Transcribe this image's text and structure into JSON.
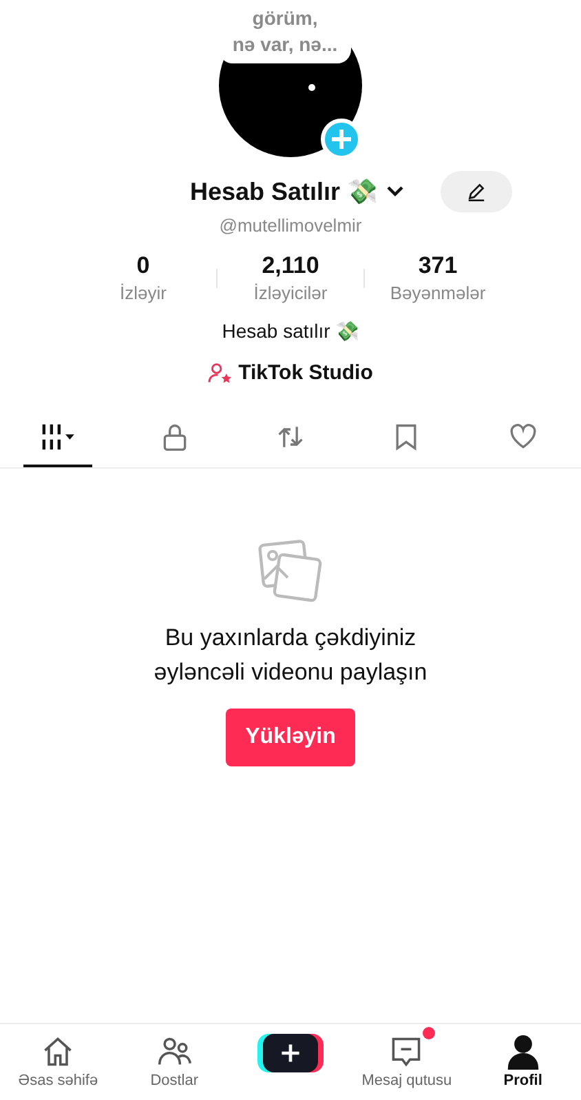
{
  "profile": {
    "note": "görüm,\nnə var, nə...",
    "name": "Hesab Satılır 💸",
    "handle": "@mutellimovelmir",
    "bio": "Hesab satılır 💸",
    "studio": "TikTok Studio"
  },
  "stats": [
    {
      "value": "0",
      "label": "İzləyir"
    },
    {
      "value": "2,110",
      "label": "İzləyicilər"
    },
    {
      "value": "371",
      "label": "Bəyənmələr"
    }
  ],
  "tabs": [
    {
      "kind": "grid",
      "selected": true
    },
    {
      "kind": "lock",
      "selected": false
    },
    {
      "kind": "repost",
      "selected": false
    },
    {
      "kind": "bookmark",
      "selected": false
    },
    {
      "kind": "heart",
      "selected": false
    }
  ],
  "empty": {
    "message": "Bu yaxınlarda çəkdiyiniz əyləncəli videonu paylaşın",
    "button": "Yükləyin"
  },
  "nav": [
    {
      "kind": "home",
      "label": "Əsas səhifə",
      "selected": false,
      "badge": false
    },
    {
      "kind": "friends",
      "label": "Dostlar",
      "selected": false,
      "badge": false
    },
    {
      "kind": "create",
      "selected": false,
      "badge": false
    },
    {
      "kind": "inbox",
      "label": "Mesaj qutusu",
      "selected": false,
      "badge": true
    },
    {
      "kind": "profile",
      "label": "Profil",
      "selected": true,
      "badge": false
    }
  ]
}
